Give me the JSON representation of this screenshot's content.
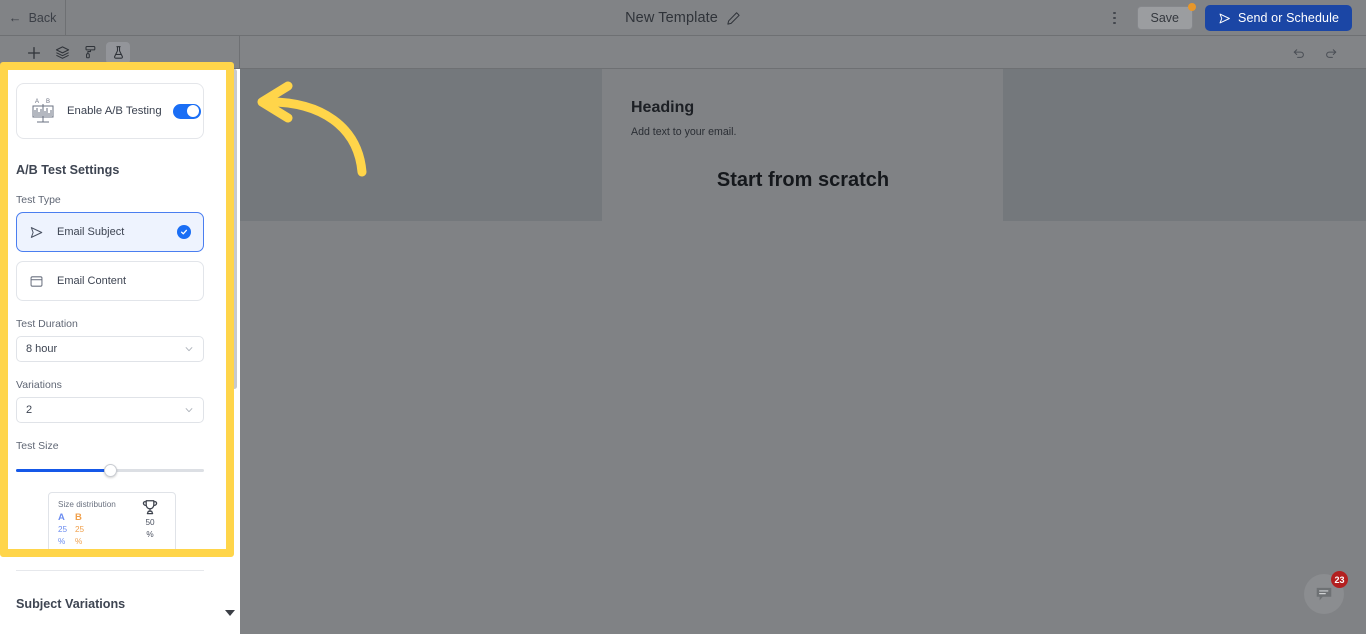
{
  "topbar": {
    "back_label": "Back",
    "title": "New Template",
    "edit_icon": "pencil-icon",
    "menu_icon": "kebab-menu-icon",
    "save_label": "Save",
    "send_label": "Send or Schedule",
    "send_icon": "send-plane-icon"
  },
  "toolbar": {
    "icons": [
      {
        "name": "plus-icon",
        "label": "Add"
      },
      {
        "name": "layers-icon",
        "label": "Layers"
      },
      {
        "name": "paint-roller-icon",
        "label": "Styles"
      },
      {
        "name": "flask-icon",
        "label": "A/B Testing"
      }
    ],
    "undo_icon": "undo-arrow-icon",
    "redo_icon": "redo-arrow-icon"
  },
  "panel": {
    "toggle_card": {
      "icon": "ab-chart-icon",
      "label": "Enable A/B Testing",
      "toggle_on": true
    },
    "settings_title": "A/B Test Settings",
    "test_type": {
      "label": "Test Type",
      "options": [
        {
          "label": "Email Subject",
          "icon": "send-plane-icon",
          "selected": true
        },
        {
          "label": "Email Content",
          "icon": "window-icon",
          "selected": false
        }
      ]
    },
    "test_duration": {
      "label": "Test Duration",
      "value": "8 hour"
    },
    "variations": {
      "label": "Variations",
      "value": "2"
    },
    "test_size": {
      "label": "Test Size",
      "slider_percent": 50,
      "distribution": {
        "title": "Size distribution",
        "a_letter": "A",
        "a_value": "25",
        "a_pct": "%",
        "b_letter": "B",
        "b_value": "25",
        "b_pct": "%",
        "winner_icon": "trophy-icon",
        "winner_value": "50",
        "winner_pct": "%"
      }
    },
    "subject_variations_title": "Subject Variations",
    "scroll_caret_icon": "caret-down-icon"
  },
  "canvas": {
    "heading": "Heading",
    "subtext": "Add text to your email.",
    "scratch": "Start from scratch"
  },
  "chat": {
    "icon": "chat-bubble-icon",
    "badge": "23"
  },
  "colors": {
    "accent_blue": "#1a6ef5",
    "send_blue": "#1b46a5",
    "highlight_yellow": "#ffd54a",
    "badge_red": "#b32020",
    "dist_a": "#6b8cf0",
    "dist_b": "#f0a04b"
  }
}
